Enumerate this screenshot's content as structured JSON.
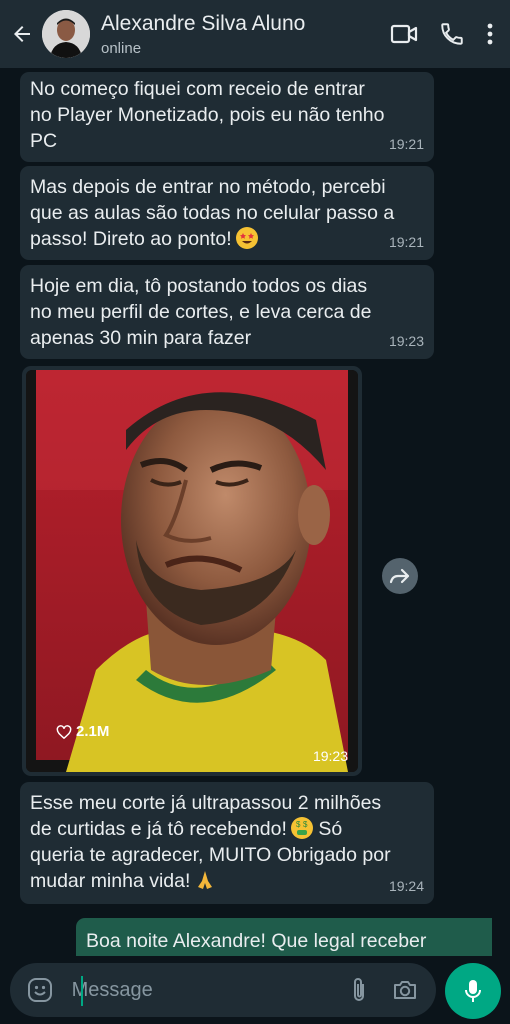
{
  "header": {
    "contact_name": "Alexandre Silva Aluno",
    "status": "online"
  },
  "messages": [
    {
      "text": "No começo fiquei com receio de entrar\nno Player Monetizado, pois eu não tenho\nPC",
      "time": "19:21"
    },
    {
      "text": "Mas depois de entrar no método, percebi\nque as aulas são todas no celular passo a\npasso! Direto ao ponto!",
      "time": "19:21",
      "emoji": "star-struck-emoji"
    },
    {
      "text": "Hoje em dia, tô postando todos os dias\nno meu perfil de cortes, e leva cerca de\napenas 30 min para fazer",
      "time": "19:23"
    },
    {
      "text": "Esse meu corte já ultrapassou 2 milhões\nde curtidas e já tô recebendo!",
      "text2": "Só\nqueria te agradecer, MUITO Obrigado por\nmudar minha vida!",
      "time": "19:24",
      "emoji": "money-mouth-emoji",
      "emoji2": "folded-hands-emoji"
    }
  ],
  "image_message": {
    "likes": "2.1M",
    "time": "19:23"
  },
  "outgoing": {
    "text": "Boa noite Alexandre! Que legal receber"
  },
  "input": {
    "placeholder": "Message"
  },
  "colors": {
    "header_bg": "#1f2c34",
    "chat_bg": "#0b141a",
    "incoming_bubble": "#1f2c34",
    "outgoing_bubble": "#1f5c4b",
    "accent": "#00a884"
  }
}
